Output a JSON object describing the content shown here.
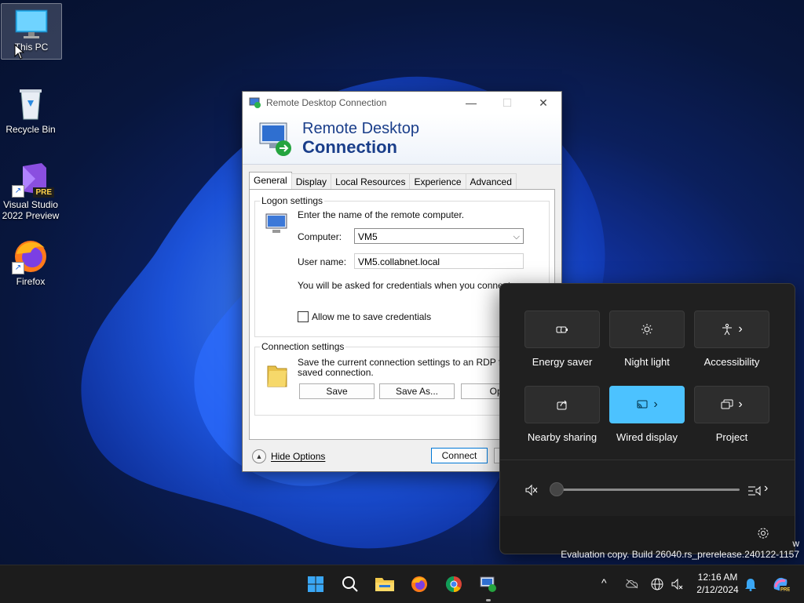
{
  "desktop": {
    "icons": [
      {
        "label": "This PC"
      },
      {
        "label": "Recycle Bin"
      },
      {
        "label": "Visual Studio 2022 Preview",
        "badge": "PRE"
      },
      {
        "label": "Firefox"
      }
    ]
  },
  "rdp": {
    "title": "Remote Desktop Connection",
    "banner_line1": "Remote Desktop",
    "banner_line2": "Connection",
    "tabs": [
      "General",
      "Display",
      "Local Resources",
      "Experience",
      "Advanced"
    ],
    "logon": {
      "group_label": "Logon settings",
      "instruction": "Enter the name of the remote computer.",
      "computer_label": "Computer:",
      "computer_value": "VM5",
      "username_label": "User name:",
      "username_value": "VM5.collabnet.local",
      "credentials_note": "You will be asked for credentials when you connect.",
      "save_credentials_label": "Allow me to save credentials",
      "save_credentials_checked": false
    },
    "connection": {
      "group_label": "Connection settings",
      "description_line1": "Save the current connection settings to an RDP file or",
      "description_line2": "saved connection.",
      "save_label": "Save",
      "save_as_label": "Save As...",
      "open_label": "Ope"
    },
    "hide_options_label": "Hide Options",
    "connect_label": "Connect",
    "minimize_glyph": "—",
    "maximize_glyph": "☐",
    "close_glyph": "✕"
  },
  "quick_settings": {
    "tiles": [
      {
        "label": "Energy saver",
        "icon": "energy-saver-icon",
        "active": false,
        "has_arrow": false
      },
      {
        "label": "Night light",
        "icon": "night-light-icon",
        "active": false,
        "has_arrow": false
      },
      {
        "label": "Accessibility",
        "icon": "accessibility-icon",
        "active": false,
        "has_arrow": true
      },
      {
        "label": "Nearby sharing",
        "icon": "share-icon",
        "active": false,
        "has_arrow": false
      },
      {
        "label": "Wired display",
        "icon": "cast-icon",
        "active": true,
        "has_arrow": true
      },
      {
        "label": "Project",
        "icon": "project-icon",
        "active": false,
        "has_arrow": true
      }
    ],
    "volume_level": 0,
    "muted": true,
    "arrow_glyph": "›",
    "accent_color": "#4cc2ff"
  },
  "watermark": {
    "line1": "w",
    "line2": "Evaluation copy. Build 26040.rs_prerelease.240122-1157"
  },
  "taskbar": {
    "apps": [
      "start-icon",
      "search-icon",
      "file-explorer-icon",
      "firefox-icon",
      "chrome-icon",
      "remote-desktop-icon"
    ],
    "tray_chevron": "^",
    "clock_time": "12:16 AM",
    "clock_date": "2/12/2024"
  }
}
